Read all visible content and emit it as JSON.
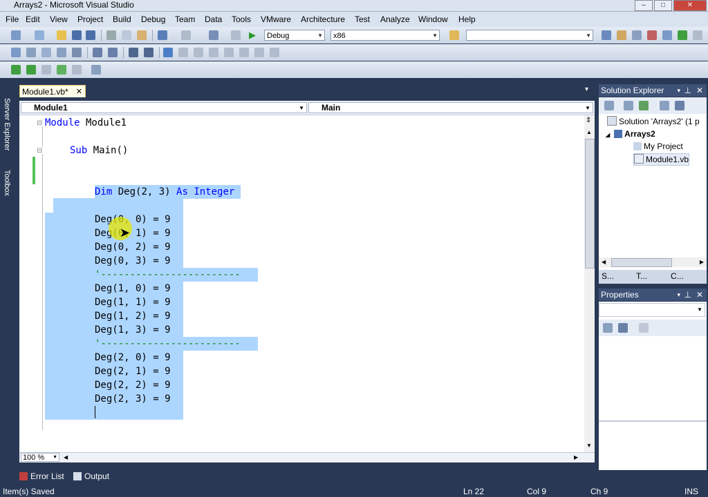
{
  "window": {
    "title": "Arrays2 - Microsoft Visual Studio",
    "minimize": "–",
    "maximize": "□",
    "close": "✕"
  },
  "menu": [
    "File",
    "Edit",
    "View",
    "Project",
    "Build",
    "Debug",
    "Team",
    "Data",
    "Tools",
    "VMware",
    "Architecture",
    "Test",
    "Analyze",
    "Window",
    "Help"
  ],
  "toolbar": {
    "config": "Debug",
    "platform": "x86",
    "find": ""
  },
  "side_tabs": {
    "server_explorer": "Server Explorer",
    "toolbox": "Toolbox"
  },
  "document_tab": {
    "label": "Module1.vb*",
    "close": "✕"
  },
  "nav": {
    "left": "Module1",
    "right": "Main"
  },
  "code_lines": [
    {
      "text": "Module Module1",
      "kw": "Module",
      "rest": " Module1"
    },
    {
      "text": "Sub Main()",
      "kw": "Sub",
      "rest": " Main()"
    },
    {
      "kw": "Dim",
      "mid": " Deg(2, 3) ",
      "kw2": "As",
      "tail": " ",
      "kw3": "Integer"
    },
    "Deg(0, 0) = 9",
    "Deg(0, 1) = 9",
    "Deg(0, 2) = 9",
    "Deg(0, 3) = 9",
    "'------------------------",
    "Deg(1, 0) = 9",
    "Deg(1, 1) = 9",
    "Deg(1, 2) = 9",
    "Deg(1, 3) = 9",
    "'------------------------",
    "Deg(2, 0) = 9",
    "Deg(2, 1) = 9",
    "Deg(2, 2) = 9",
    "Deg(2, 3) = 9"
  ],
  "zoom": "100 %",
  "bottom_tabs": {
    "error_list": "Error List",
    "output": "Output"
  },
  "status": {
    "message": "Item(s) Saved",
    "ln": "Ln 22",
    "col": "Col 9",
    "ch": "Ch 9",
    "mode": "INS"
  },
  "solution_explorer": {
    "title": "Solution Explorer",
    "items": [
      "Solution 'Arrays2' (1 p",
      "Arrays2",
      "My Project",
      "Module1.vb"
    ],
    "tabs": [
      "S...",
      "T...",
      "C..."
    ]
  },
  "properties": {
    "title": "Properties",
    "selected": ""
  },
  "colors": {
    "keyword": "#0000ff",
    "selection": "#add6ff",
    "chrome": "#293955",
    "current_line_cursor": "#e6e600"
  }
}
